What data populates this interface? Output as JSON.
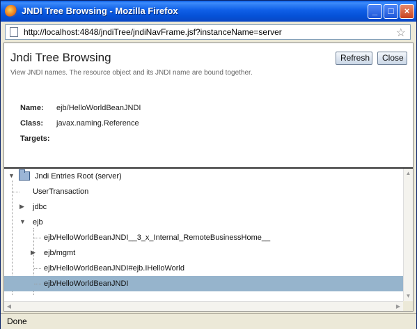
{
  "window": {
    "title": "JNDI Tree Browsing - Mozilla Firefox"
  },
  "address_bar": {
    "url": "http://localhost:4848/jndiTree/jndiNavFrame.jsf?instanceName=server"
  },
  "page": {
    "title": "Jndi Tree Browsing",
    "description": "View JNDI names. The resource object and its JNDI name are bound together.",
    "buttons": {
      "refresh": "Refresh",
      "close": "Close"
    },
    "properties": {
      "name_label": "Name:",
      "name_value": "ejb/HelloWorldBeanJNDI",
      "class_label": "Class:",
      "class_value": "javax.naming.Reference",
      "targets_label": "Targets:"
    }
  },
  "tree": {
    "root": "Jndi Entries Root (server)",
    "items": [
      "UserTransaction",
      "jdbc",
      "ejb",
      "ejb/HelloWorldBeanJNDI__3_x_Internal_RemoteBusinessHome__",
      "ejb/mgmt",
      "ejb/HelloWorldBeanJNDI#ejb.IHelloWorld",
      "ejb/HelloWorldBeanJNDI"
    ]
  },
  "status": {
    "text": "Done"
  }
}
